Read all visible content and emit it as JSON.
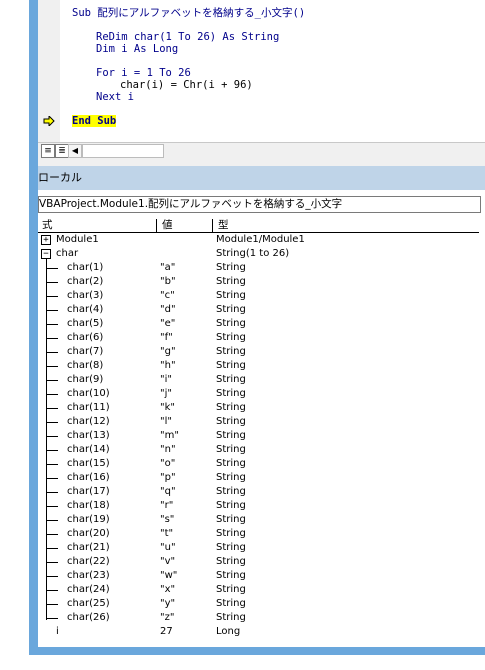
{
  "code": {
    "lines": [
      "Sub 配列にアルファベットを格納する_小文字()",
      "ReDim char(1 To 26) As String",
      "Dim i As Long",
      "For i = 1 To 26",
      "char(i) = Chr(i + 96)",
      "Next i",
      "End Sub"
    ]
  },
  "locals": {
    "title": "ローカル",
    "context": "VBAProject.Module1.配列にアルファベットを格納する_小文字",
    "headers": {
      "expression": "式",
      "value": "値",
      "type": "型"
    },
    "module_row": {
      "expr": "Module1",
      "value": "",
      "type": "Module1/Module1"
    },
    "char_row": {
      "expr": "char",
      "value": "",
      "type": "String(1 to 26)"
    },
    "items": [
      {
        "expr": "char(1)",
        "value": "\"a\"",
        "type": "String"
      },
      {
        "expr": "char(2)",
        "value": "\"b\"",
        "type": "String"
      },
      {
        "expr": "char(3)",
        "value": "\"c\"",
        "type": "String"
      },
      {
        "expr": "char(4)",
        "value": "\"d\"",
        "type": "String"
      },
      {
        "expr": "char(5)",
        "value": "\"e\"",
        "type": "String"
      },
      {
        "expr": "char(6)",
        "value": "\"f\"",
        "type": "String"
      },
      {
        "expr": "char(7)",
        "value": "\"g\"",
        "type": "String"
      },
      {
        "expr": "char(8)",
        "value": "\"h\"",
        "type": "String"
      },
      {
        "expr": "char(9)",
        "value": "\"i\"",
        "type": "String"
      },
      {
        "expr": "char(10)",
        "value": "\"j\"",
        "type": "String"
      },
      {
        "expr": "char(11)",
        "value": "\"k\"",
        "type": "String"
      },
      {
        "expr": "char(12)",
        "value": "\"l\"",
        "type": "String"
      },
      {
        "expr": "char(13)",
        "value": "\"m\"",
        "type": "String"
      },
      {
        "expr": "char(14)",
        "value": "\"n\"",
        "type": "String"
      },
      {
        "expr": "char(15)",
        "value": "\"o\"",
        "type": "String"
      },
      {
        "expr": "char(16)",
        "value": "\"p\"",
        "type": "String"
      },
      {
        "expr": "char(17)",
        "value": "\"q\"",
        "type": "String"
      },
      {
        "expr": "char(18)",
        "value": "\"r\"",
        "type": "String"
      },
      {
        "expr": "char(19)",
        "value": "\"s\"",
        "type": "String"
      },
      {
        "expr": "char(20)",
        "value": "\"t\"",
        "type": "String"
      },
      {
        "expr": "char(21)",
        "value": "\"u\"",
        "type": "String"
      },
      {
        "expr": "char(22)",
        "value": "\"v\"",
        "type": "String"
      },
      {
        "expr": "char(23)",
        "value": "\"w\"",
        "type": "String"
      },
      {
        "expr": "char(24)",
        "value": "\"x\"",
        "type": "String"
      },
      {
        "expr": "char(25)",
        "value": "\"y\"",
        "type": "String"
      },
      {
        "expr": "char(26)",
        "value": "\"z\"",
        "type": "String"
      }
    ],
    "i_row": {
      "expr": "i",
      "value": "27",
      "type": "Long"
    }
  },
  "icons": {
    "exec_arrow": "current-line-arrow-icon",
    "procedure_view": "procedure-view-icon",
    "full_module_view": "full-module-view-icon",
    "scroll_left": "scroll-left-arrow-icon",
    "expand": "plus-expander-icon",
    "collapse": "minus-expander-icon"
  },
  "colors": {
    "frame": "#6aa7dc",
    "keyword": "#00008b",
    "highlight": "#ffff00",
    "locals_title_bg": "#bfd4e8"
  }
}
